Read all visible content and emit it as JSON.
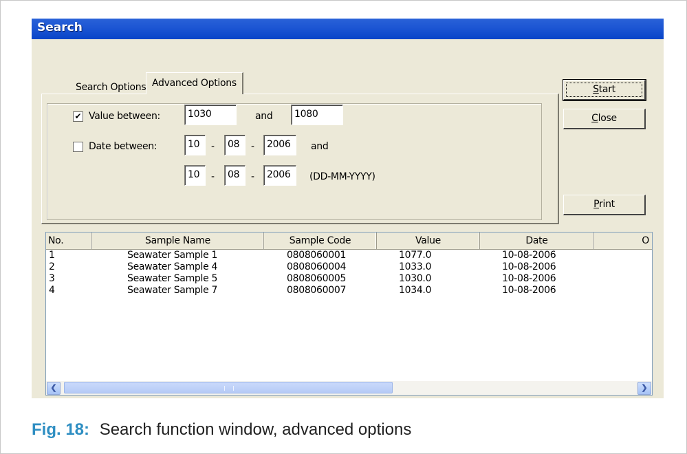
{
  "window": {
    "title": "Search"
  },
  "tabs": [
    {
      "label": "Search Options"
    },
    {
      "label": "Advanced Options"
    }
  ],
  "filters": {
    "value_enabled": true,
    "value_label": "Value between:",
    "value_min": "1030",
    "and_label": "and",
    "value_max": "1080",
    "date_enabled": false,
    "date_label": "Date between:",
    "date_from": {
      "day": "10",
      "month": "08",
      "year": "2006"
    },
    "date_to": {
      "day": "10",
      "month": "08",
      "year": "2006"
    },
    "date_separator": "-",
    "date_format_hint": "(DD-MM-YYYY)"
  },
  "buttons": {
    "start": {
      "mnemonic": "S",
      "rest": "tart"
    },
    "close": {
      "mnemonic": "C",
      "rest": "lose"
    },
    "print": {
      "mnemonic": "P",
      "rest": "rint"
    }
  },
  "results": {
    "columns": [
      "No.",
      "Sample Name",
      "Sample Code",
      "Value",
      "Date",
      "O"
    ],
    "rows": [
      [
        "1",
        "Seawater Sample 1",
        "0808060001",
        "1077.0",
        "10-08-2006"
      ],
      [
        "2",
        "Seawater Sample 4",
        "0808060004",
        "1033.0",
        "10-08-2006"
      ],
      [
        "3",
        "Seawater Sample 5",
        "0808060005",
        "1030.0",
        "10-08-2006"
      ],
      [
        "4",
        "Seawater Sample 7",
        "0808060007",
        "1034.0",
        "10-08-2006"
      ]
    ]
  },
  "scrollbar": {
    "left_icon": "arrow-left-icon",
    "right_icon": "arrow-right-icon"
  },
  "caption": {
    "label": "Fig. 18:",
    "text": "Search function window, advanced options"
  }
}
